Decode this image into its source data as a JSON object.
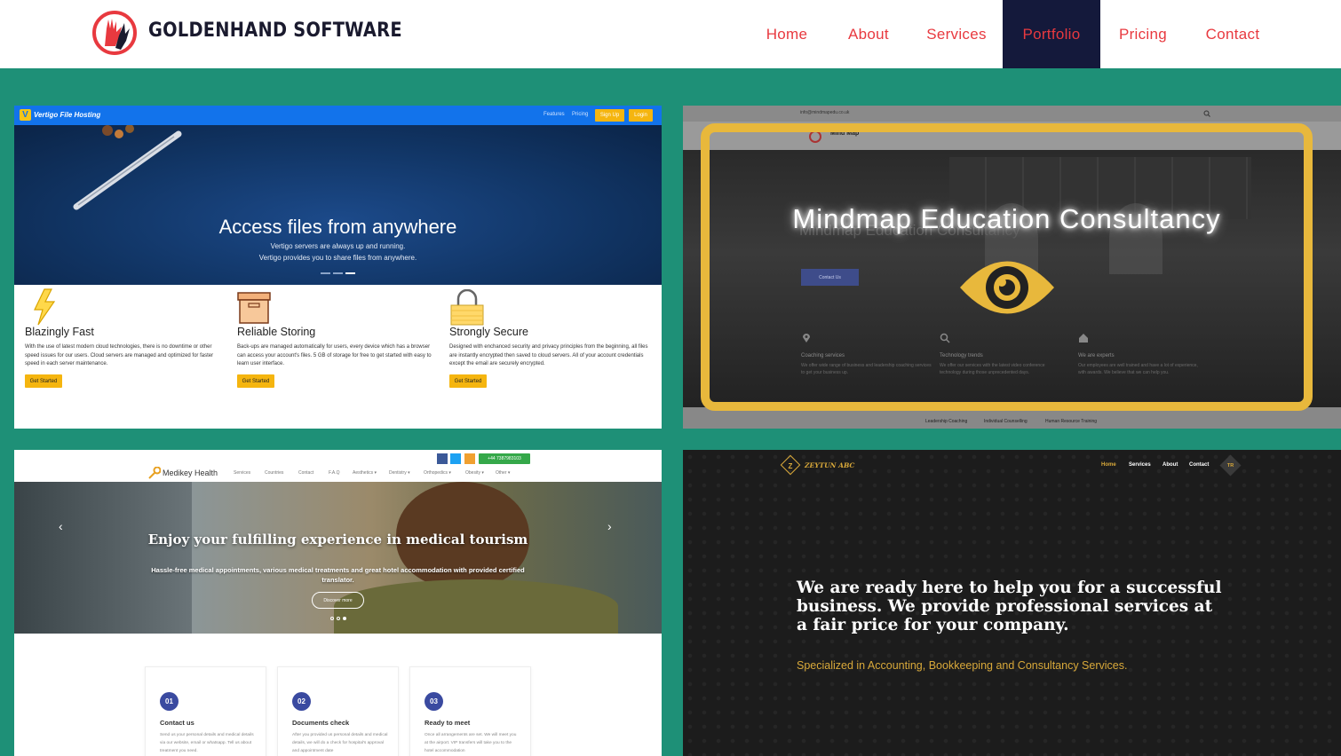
{
  "brand": {
    "name": "GOLDENHAND SOFTWARE",
    "colors": {
      "accent": "#e8393f",
      "navy": "#14193b",
      "teal": "#1e9077"
    }
  },
  "nav": [
    {
      "label": "Home",
      "active": false
    },
    {
      "label": "About",
      "active": false
    },
    {
      "label": "Services",
      "active": false
    },
    {
      "label": "Portfolio",
      "active": true
    },
    {
      "label": "Pricing",
      "active": false
    },
    {
      "label": "Contact",
      "active": false
    }
  ],
  "vertigo": {
    "logo_letter": "V",
    "title": "Vertigo File Hosting",
    "nav": [
      "Features",
      "Pricing"
    ],
    "signup": "Sign Up",
    "login": "Login",
    "hero_title": "Access files from anywhere",
    "hero_sub1": "Vertigo servers are always up and running.",
    "hero_sub2": "Vertigo provides you to share files from anywhere.",
    "features": [
      {
        "icon": "lightning-icon",
        "title": "Blazingly Fast",
        "text": "With the use of latest modern cloud technologies, there is no downtime or other speed issues for our users. Cloud servers are managed and optimized for faster speed in each server maintenance.",
        "button": "Get Started"
      },
      {
        "icon": "archive-box-icon",
        "title": "Reliable Storing",
        "text": "Back-ups are managed automatically for users, every device which has a browser can access your account's files. 5 GB of storage for free to get started with easy to learn user interface.",
        "button": "Get Started"
      },
      {
        "icon": "lock-icon",
        "title": "Strongly Secure",
        "text": "Designed with enchanced security and privacy principles from the beginning, all files are instantly encrypted then saved to cloud servers. All of your account credentials except the email are securely encrypted.",
        "button": "Get Started"
      }
    ]
  },
  "mindmap": {
    "email": "info@mindmapedu.co.uk",
    "logo_text": "Mind Map",
    "overlay_title": "Mindmap Education Consultancy",
    "hero_title": "Mindmap Education Consultancy",
    "contact_button": "Contact Us",
    "features": [
      {
        "icon": "map-pin-icon",
        "title": "Coaching services",
        "text": "We offer wide range of business and leadership coaching services to get your business up."
      },
      {
        "icon": "magnifier-icon",
        "title": "Technology trends",
        "text": "We offer our services with the latest video conference technology during those unprecedented days."
      },
      {
        "icon": "home-icon",
        "title": "We are experts",
        "text": "Our employees are well trained and have a lot of experience, with awards. We believe that we can help you."
      }
    ],
    "footer_links": [
      "Leadership Coaching",
      "Individual Counselling",
      "Human Resource Training"
    ]
  },
  "medikey": {
    "logo": "Medikey Health",
    "nav": [
      "Services",
      "Countries",
      "Contact",
      "F.A.Q",
      "Aesthetics ▾",
      "Dentistry ▾",
      "Orthopedics ▾",
      "Obesity ▾",
      "Other ▾"
    ],
    "phone": "+44 7387983103",
    "hero_title": "Enjoy your fulfilling experience in medical tourism",
    "hero_sub": "Hassle-free medical appointments, various medical treatments and great hotel accommodation with provided certified translator.",
    "hero_button": "Discover more",
    "steps": [
      {
        "num": "01",
        "title": "Contact us",
        "text": "Send us your personal details and medical details via our website, email or whatsapp. Tell us about treatment you need."
      },
      {
        "num": "02",
        "title": "Documents check",
        "text": "After you provided us personal details and medical details, we will do a check for hospital's approval and appointment date"
      },
      {
        "num": "03",
        "title": "Ready to meet",
        "text": "Once all arrangements are set. We will meet you at the airport. VIP transfers will take you to the hotel accommodation"
      }
    ]
  },
  "zeytun": {
    "logo": "ZEYTUN ABC",
    "logo_letter": "Z",
    "nav": [
      "Home",
      "Services",
      "About",
      "Contact"
    ],
    "lang": "TR",
    "headline": "We are ready here to help you for a successful business. We provide professional services at a fair price for your company.",
    "sub": "Specialized in Accounting, Bookkeeping and Consultancy Services."
  }
}
